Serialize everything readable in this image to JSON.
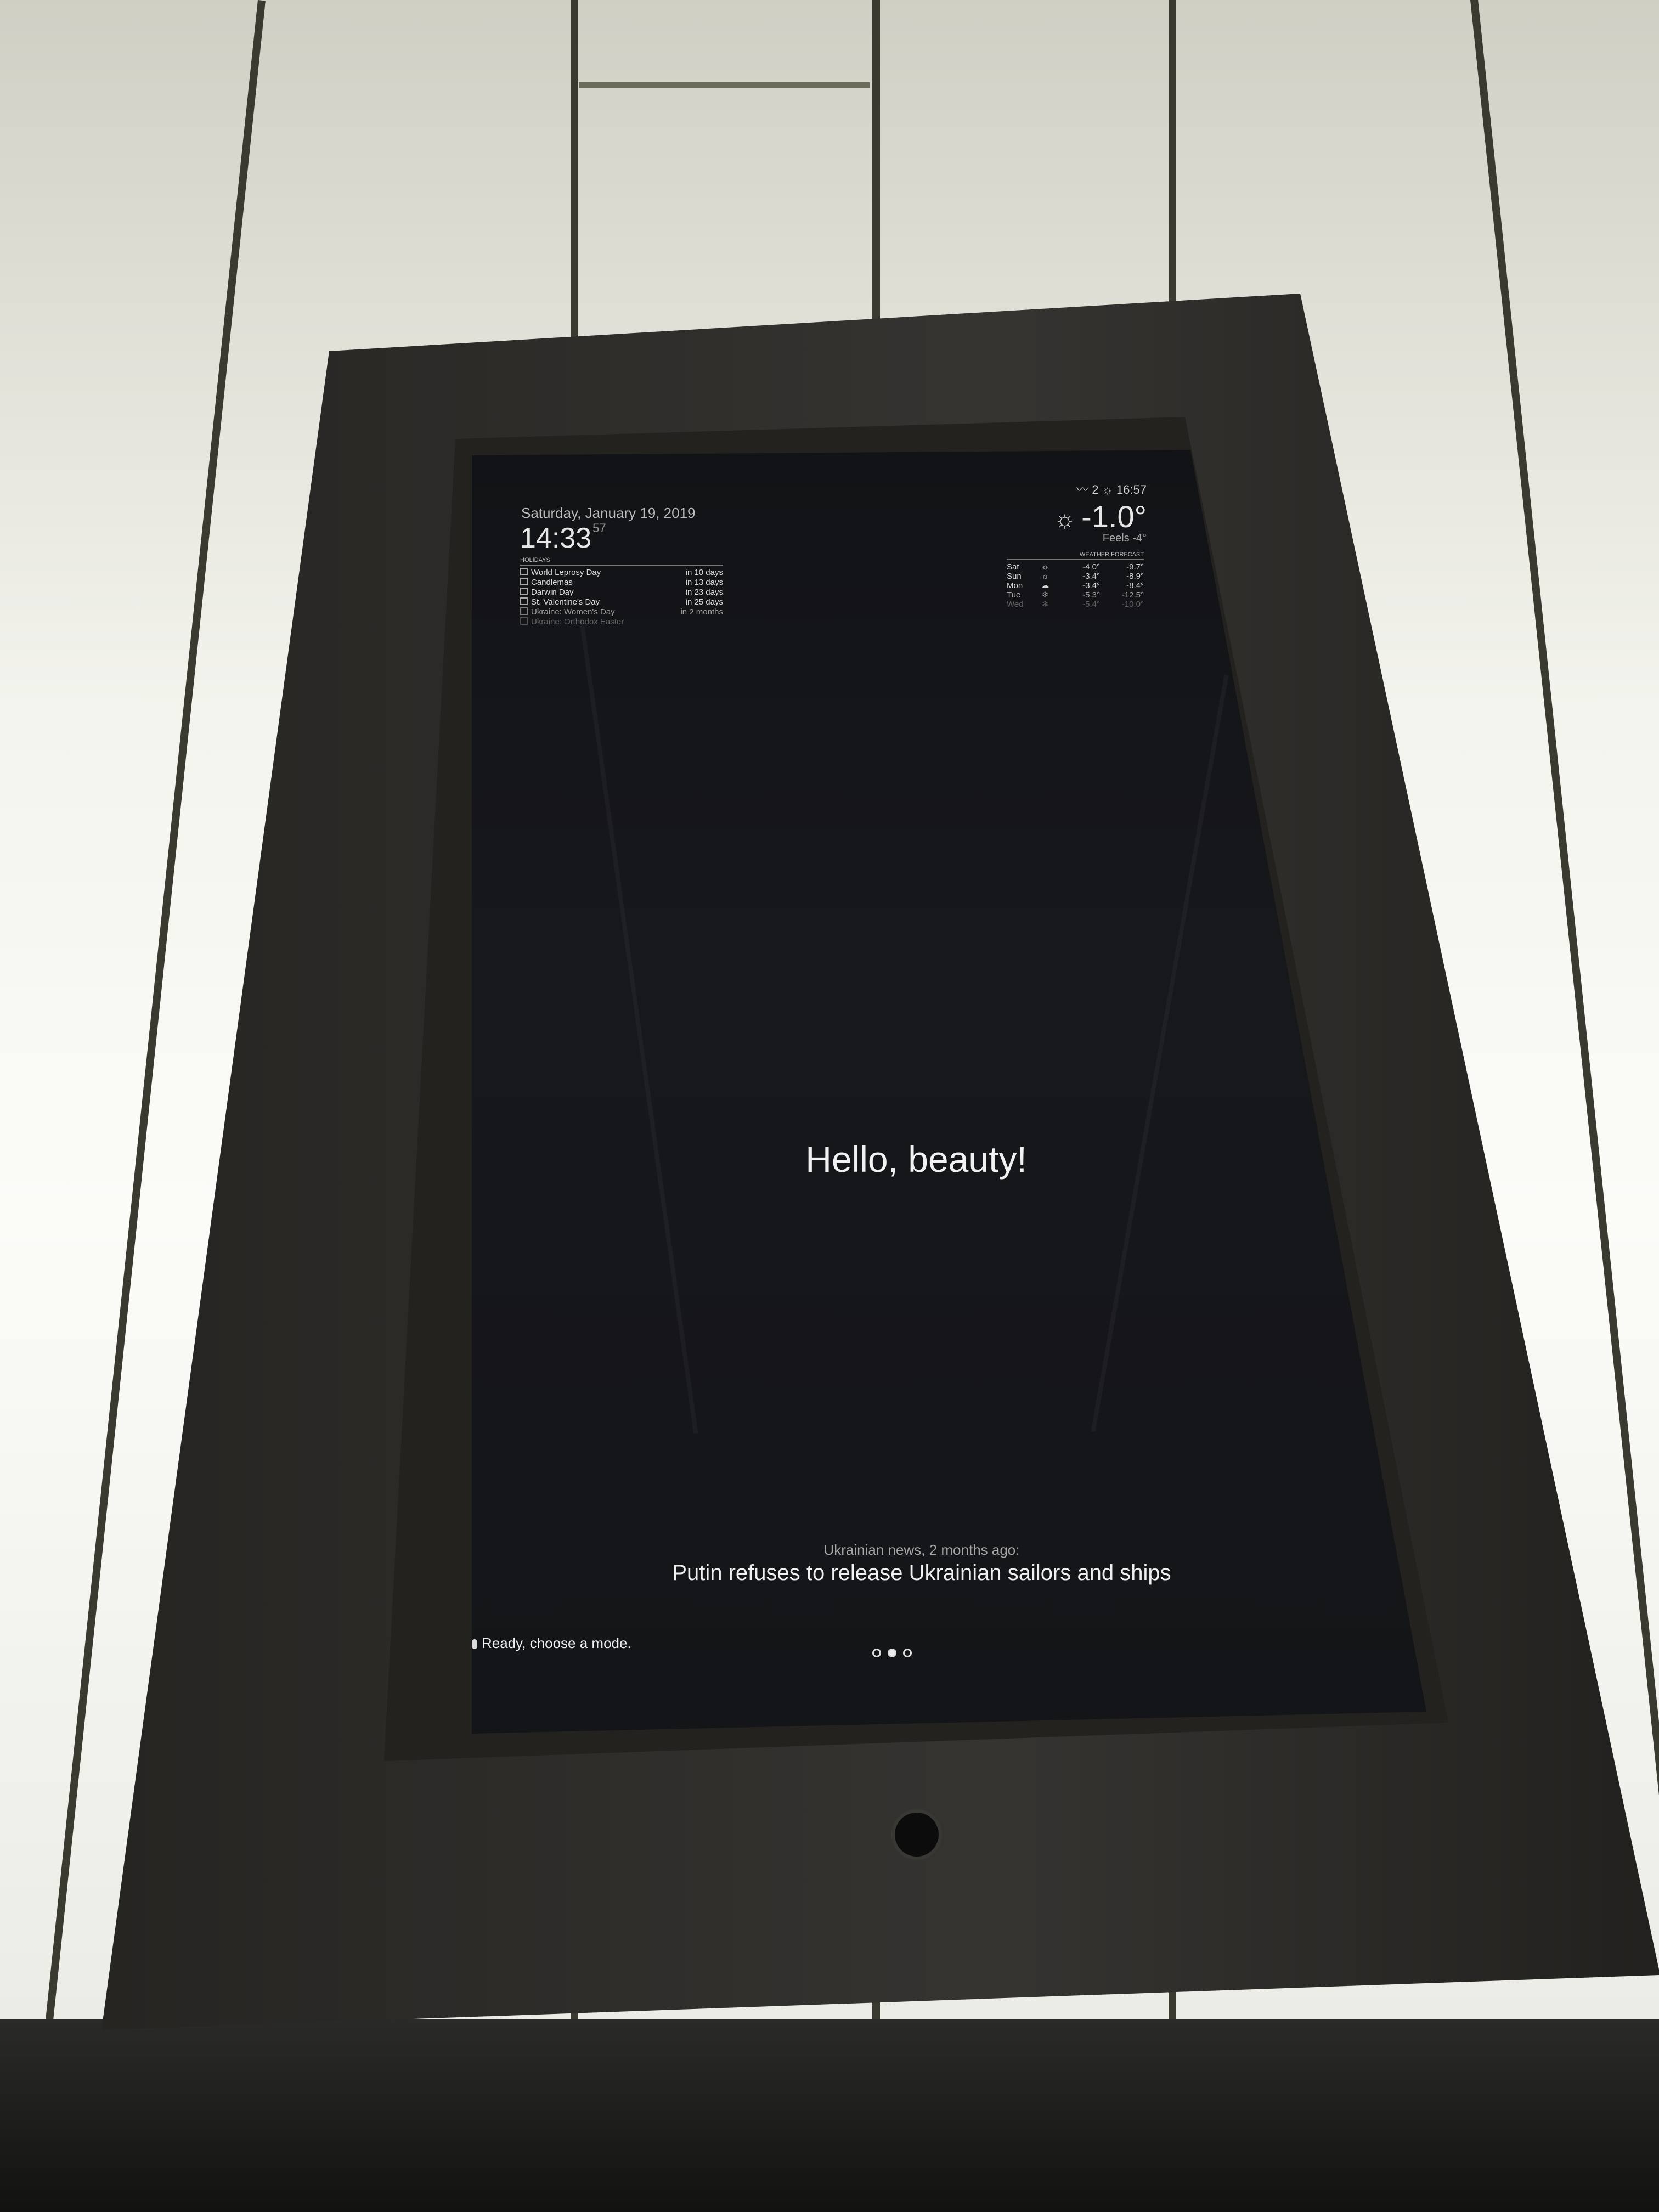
{
  "clock": {
    "date": "Saturday, January 19, 2019",
    "time": "14:33",
    "seconds": "57"
  },
  "holidays": {
    "header": "HOLIDAYS",
    "items": [
      {
        "name": "World Leprosy Day",
        "when": "in 10 days"
      },
      {
        "name": "Candlemas",
        "when": "in 13 days"
      },
      {
        "name": "Darwin Day",
        "when": "in 23 days"
      },
      {
        "name": "St. Valentine's Day",
        "when": "in 25 days"
      },
      {
        "name": "Ukraine: Women's Day",
        "when": "in 2 months"
      },
      {
        "name": "Ukraine: Orthodox Easter",
        "when": ""
      }
    ]
  },
  "weather": {
    "wind": "2",
    "sunset": "16:57",
    "temperature": "-1.0°",
    "feels_like": "Feels -4°",
    "forecast_header": "WEATHER FORECAST",
    "forecast": [
      {
        "day": "Sat",
        "hi": "-4.0°",
        "lo": "-9.7°"
      },
      {
        "day": "Sun",
        "hi": "-3.4°",
        "lo": "-8.9°"
      },
      {
        "day": "Mon",
        "hi": "-3.4°",
        "lo": "-8.4°"
      },
      {
        "day": "Tue",
        "hi": "-5.3°",
        "lo": "-12.5°"
      },
      {
        "day": "Wed",
        "hi": "-5.4°",
        "lo": "-10.0°"
      }
    ]
  },
  "compliment": "Hello, beauty!",
  "news": {
    "source": "Ukrainian news, 2 months ago:",
    "headline": "Putin refuses to release Ukrainian sailors and ships"
  },
  "status": "Ready, choose a mode.",
  "pager": {
    "count": 3,
    "active": 2
  }
}
